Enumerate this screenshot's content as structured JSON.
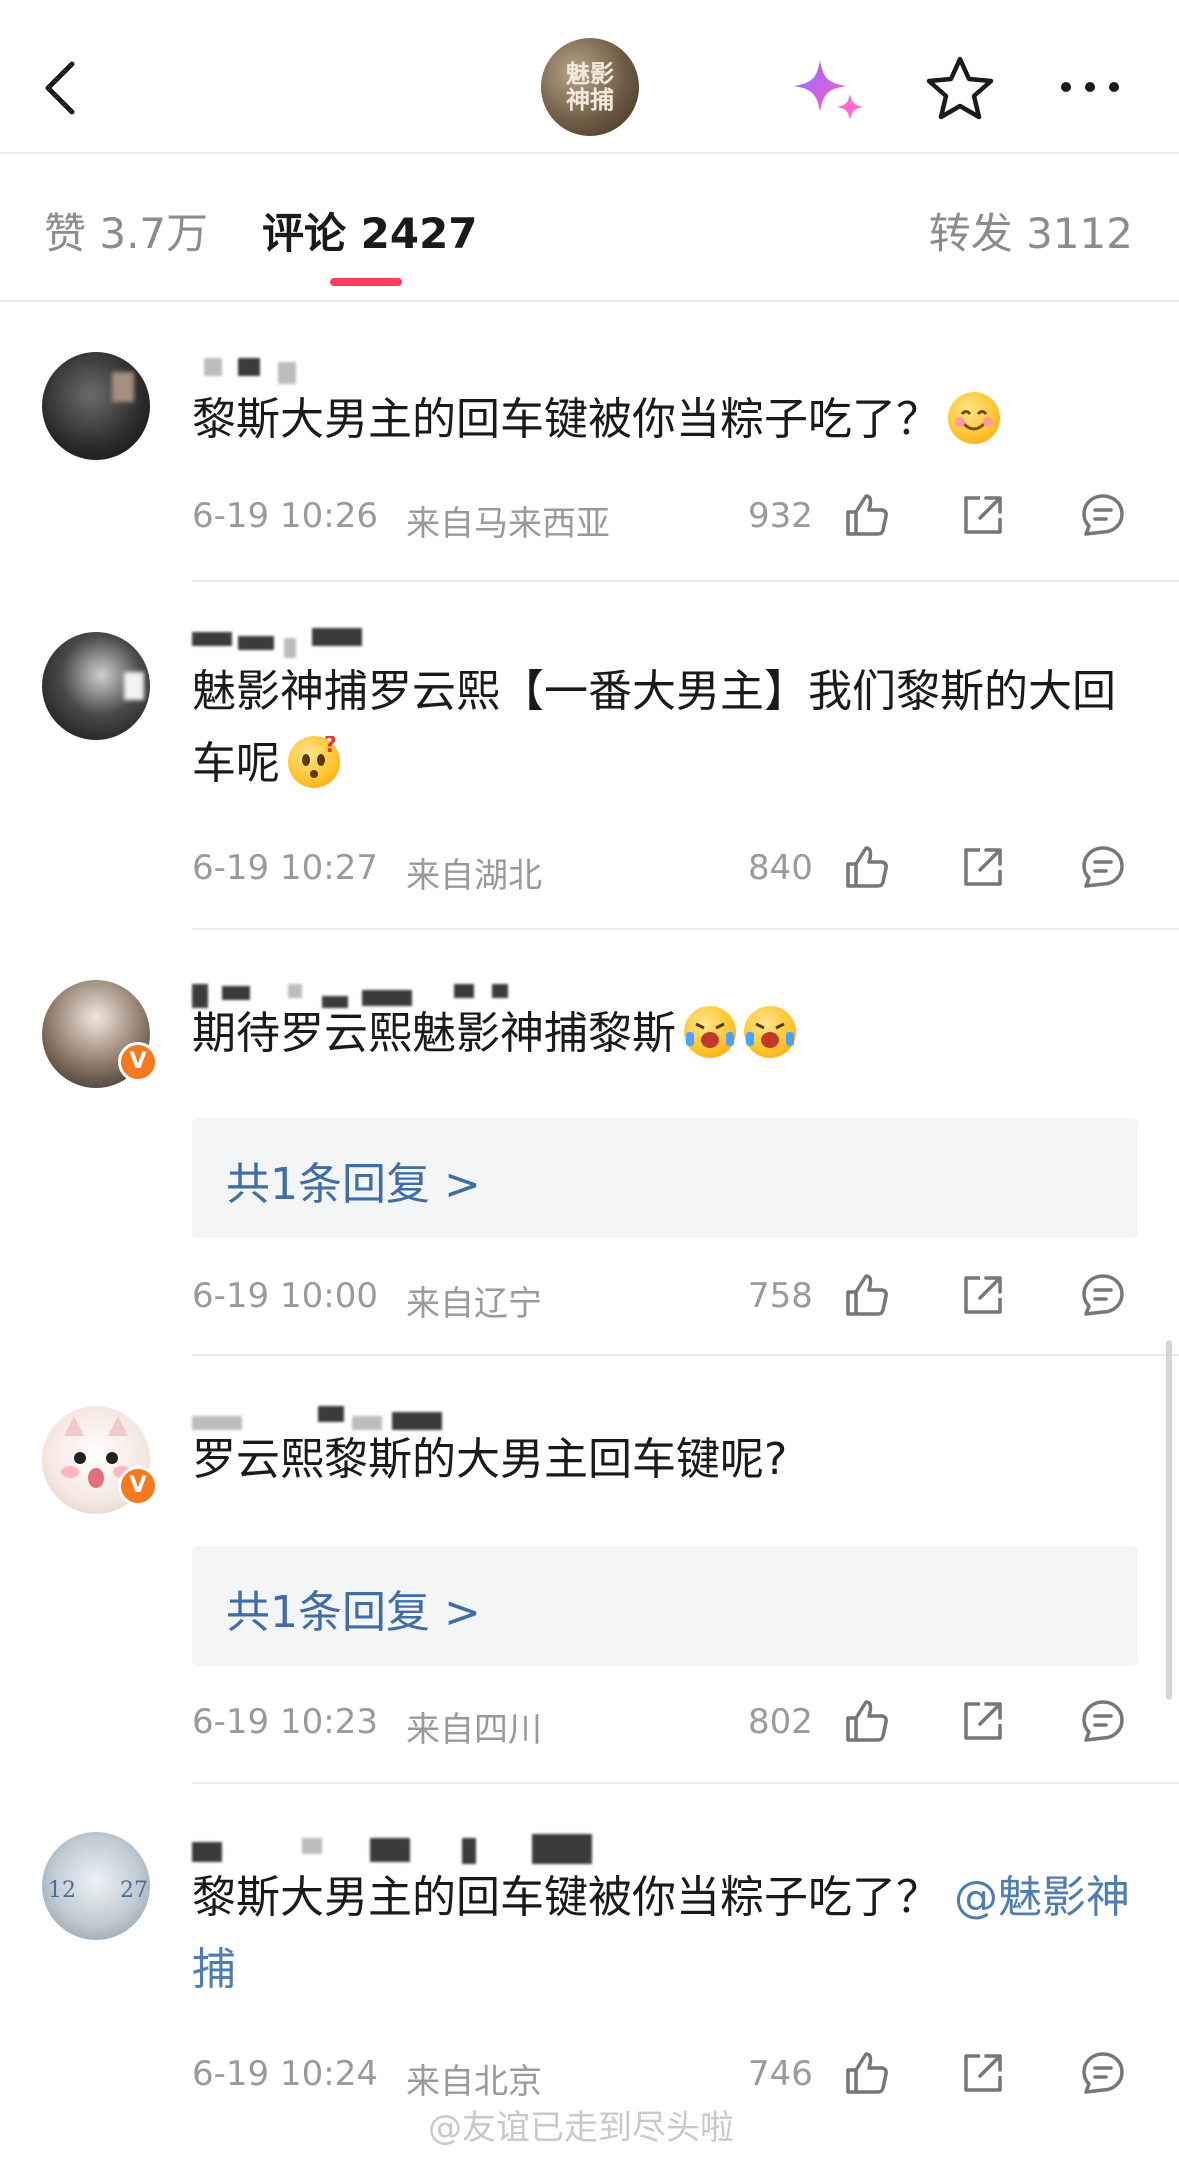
{
  "header": {
    "account_avatar_text": "魅影神捕",
    "icons": [
      "back-arrow-icon",
      "sparkle-icon",
      "star-icon",
      "more-icon"
    ]
  },
  "tabs": {
    "likes": "赞 3.7万",
    "comments": "评论 2427",
    "reposts": "转发 3112",
    "active": "comments",
    "accent_color": "#ff3c5a"
  },
  "comments": [
    {
      "text": "黎斯大男主的回车键被你当粽子吃了？",
      "emoji": "smiling-blush-emoji",
      "time": "6-19 10:26",
      "location": "来自马来西亚",
      "likes": "932"
    },
    {
      "text": "魅影神捕罗云熙【一番大男主】我们黎斯的大回车呢",
      "emoji": "confused-question-emoji",
      "time": "6-19 10:27",
      "location": "来自湖北",
      "likes": "840"
    },
    {
      "text": "期待罗云熙魅影神捕黎斯",
      "emoji": "screaming-joy-emoji",
      "reply_summary": "共1条回复 >",
      "time": "6-19 10:00",
      "location": "来自辽宁",
      "likes": "758",
      "verified": true
    },
    {
      "text": "罗云熙黎斯的大男主回车键呢?",
      "reply_summary": "共1条回复 >",
      "time": "6-19 10:23",
      "location": "来自四川",
      "likes": "802",
      "verified": true
    },
    {
      "text": "黎斯大男主的回车键被你当粽子吃了？",
      "mention": "@魅影神捕",
      "time": "6-19 10:24",
      "location": "来自北京",
      "likes": "746"
    }
  ],
  "watermark": "@友谊已走到尽头啦",
  "colors": {
    "link": "#507daf",
    "reply_link": "#3f6ea6",
    "verified": "#f5791f",
    "meta_gray": "#9a9a9a"
  }
}
